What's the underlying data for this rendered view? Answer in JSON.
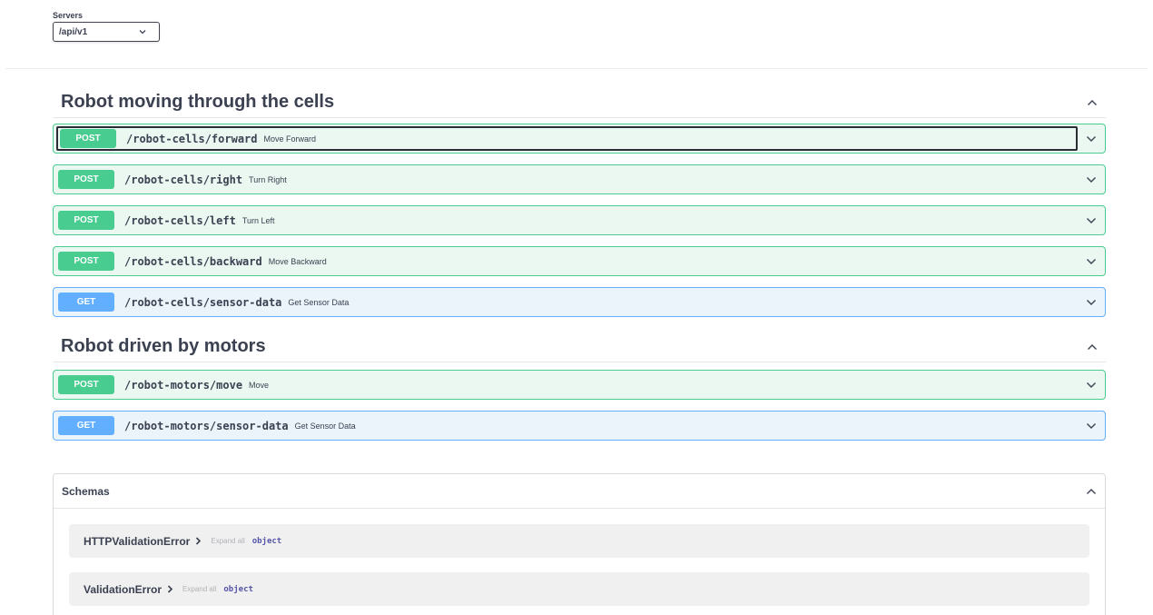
{
  "servers": {
    "label": "Servers",
    "selected": "/api/v1"
  },
  "tags": [
    {
      "title": "Robot moving through the cells",
      "operations": [
        {
          "method": "POST",
          "path": "/robot-cells/forward",
          "summary": "Move Forward"
        },
        {
          "method": "POST",
          "path": "/robot-cells/right",
          "summary": "Turn Right"
        },
        {
          "method": "POST",
          "path": "/robot-cells/left",
          "summary": "Turn Left"
        },
        {
          "method": "POST",
          "path": "/robot-cells/backward",
          "summary": "Move Backward"
        },
        {
          "method": "GET",
          "path": "/robot-cells/sensor-data",
          "summary": "Get Sensor Data"
        }
      ]
    },
    {
      "title": "Robot driven by motors",
      "operations": [
        {
          "method": "POST",
          "path": "/robot-motors/move",
          "summary": "Move"
        },
        {
          "method": "GET",
          "path": "/robot-motors/sensor-data",
          "summary": "Get Sensor Data"
        }
      ]
    }
  ],
  "schemas": {
    "title": "Schemas",
    "items": [
      {
        "name": "HTTPValidationError",
        "expand": "Expand all",
        "type": "object"
      },
      {
        "name": "ValidationError",
        "expand": "Expand all",
        "type": "object"
      }
    ]
  },
  "colors": {
    "post": "#49cc90",
    "get": "#61affe"
  },
  "icons": {
    "collapse": "chevron-up-icon",
    "expand": "chevron-down-icon",
    "schema_expand": "chevron-right-icon"
  }
}
